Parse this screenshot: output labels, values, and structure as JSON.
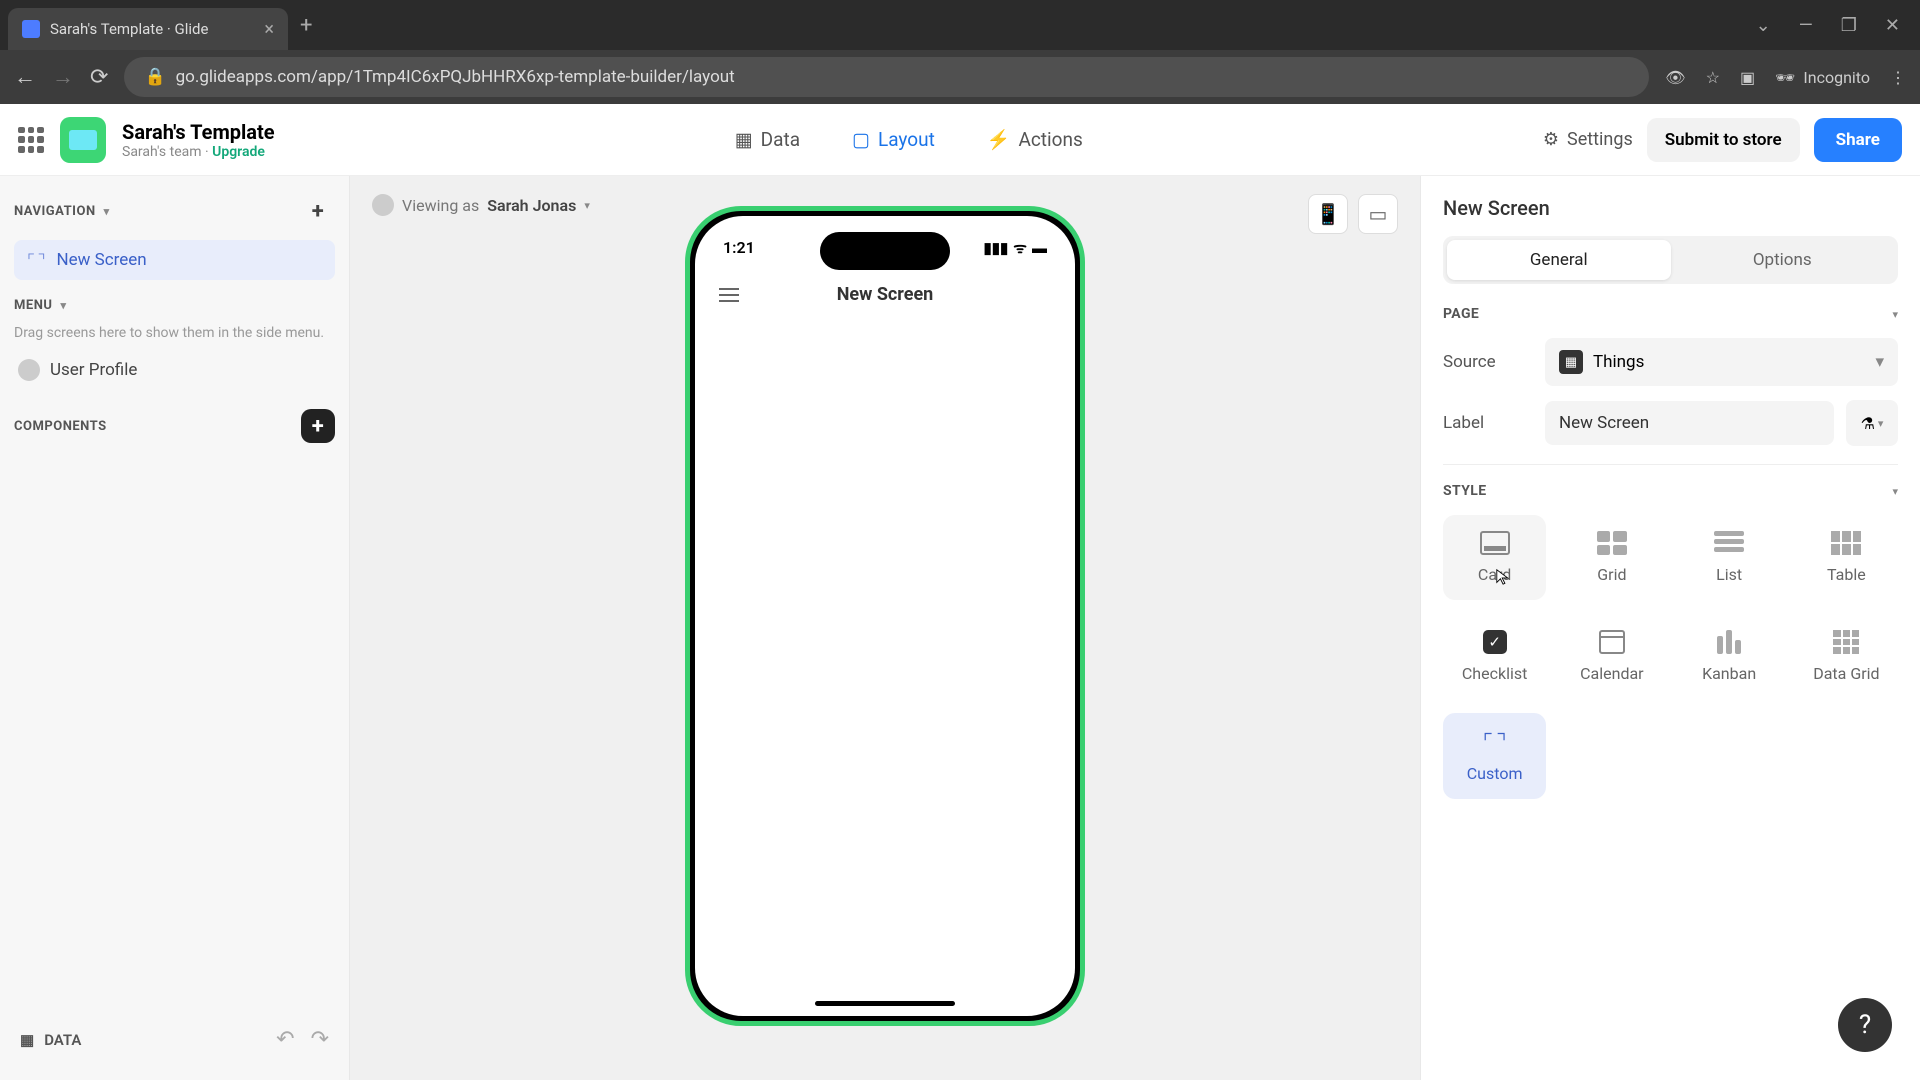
{
  "browser": {
    "tab_title": "Sarah's Template · Glide",
    "url": "go.glideapps.com/app/1Tmp4IC6xPQJbHHRX6xp-template-builder/layout",
    "incognito_label": "Incognito"
  },
  "header": {
    "app_title": "Sarah's Template",
    "team": "Sarah's team",
    "upgrade": "Upgrade",
    "tabs": {
      "data": "Data",
      "layout": "Layout",
      "actions": "Actions"
    },
    "settings": "Settings",
    "submit": "Submit to store",
    "share": "Share"
  },
  "left": {
    "navigation": "NAVIGATION",
    "screen_item": "New Screen",
    "menu": "MENU",
    "drag_hint": "Drag screens here to show them in the side menu.",
    "user_profile": "User Profile",
    "components": "COMPONENTS",
    "data_link": "DATA"
  },
  "canvas": {
    "viewing_prefix": "Viewing as ",
    "viewing_user": "Sarah Jonas",
    "phone_time": "1:21",
    "phone_title": "New Screen"
  },
  "right": {
    "title": "New Screen",
    "tab_general": "General",
    "tab_options": "Options",
    "section_page": "PAGE",
    "source_label": "Source",
    "source_value": "Things",
    "label_label": "Label",
    "label_value": "New Screen",
    "section_style": "STYLE",
    "styles": {
      "card": "Card",
      "grid": "Grid",
      "list": "List",
      "table": "Table",
      "checklist": "Checklist",
      "calendar": "Calendar",
      "kanban": "Kanban",
      "datagrid": "Data Grid",
      "custom": "Custom"
    }
  }
}
